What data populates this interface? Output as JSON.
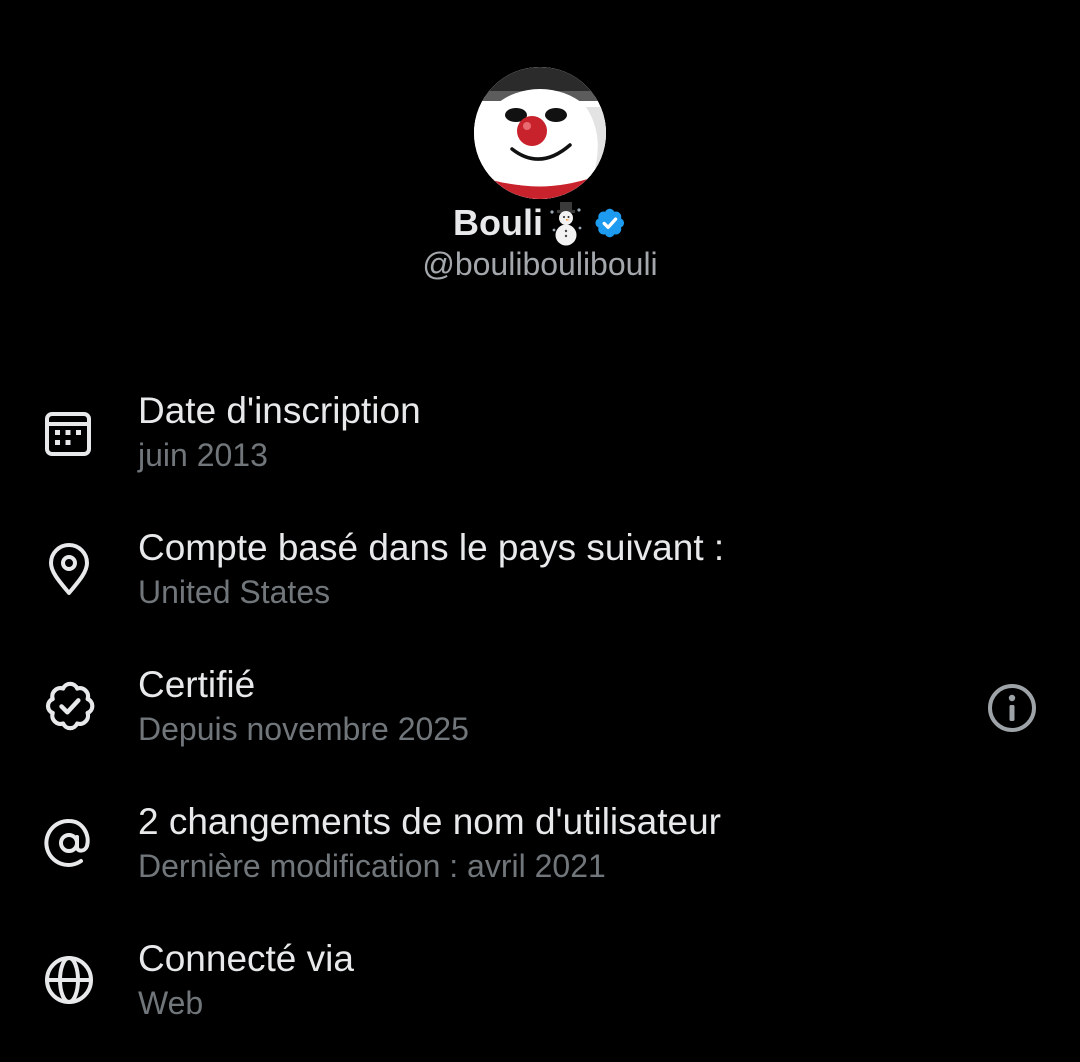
{
  "profile": {
    "display_name": "Bouli",
    "name_emoji": "snowman-emoji",
    "verified_icon": "verified-badge-icon",
    "handle": "@bouliboulibouli",
    "avatar_icon": "snowman-avatar",
    "accent_color": "#1d9bf0"
  },
  "about": {
    "items": [
      {
        "icon": "calendar-icon",
        "title": "Date d'inscription",
        "subtitle": "juin 2013"
      },
      {
        "icon": "location-pin-icon",
        "title": "Compte basé dans le pays suivant :",
        "subtitle": "United States"
      },
      {
        "icon": "verified-outline-icon",
        "title": "Certifié",
        "subtitle": "Depuis novembre 2025",
        "action_icon": "info-icon"
      },
      {
        "icon": "at-sign-icon",
        "title": "2 changements de nom d'utilisateur",
        "subtitle": "Dernière modification : avril 2021"
      },
      {
        "icon": "globe-icon",
        "title": "Connecté via",
        "subtitle": "Web"
      }
    ]
  },
  "colors": {
    "background": "#000000",
    "primary_text": "#e7e9ea",
    "secondary_text": "#71767b"
  }
}
